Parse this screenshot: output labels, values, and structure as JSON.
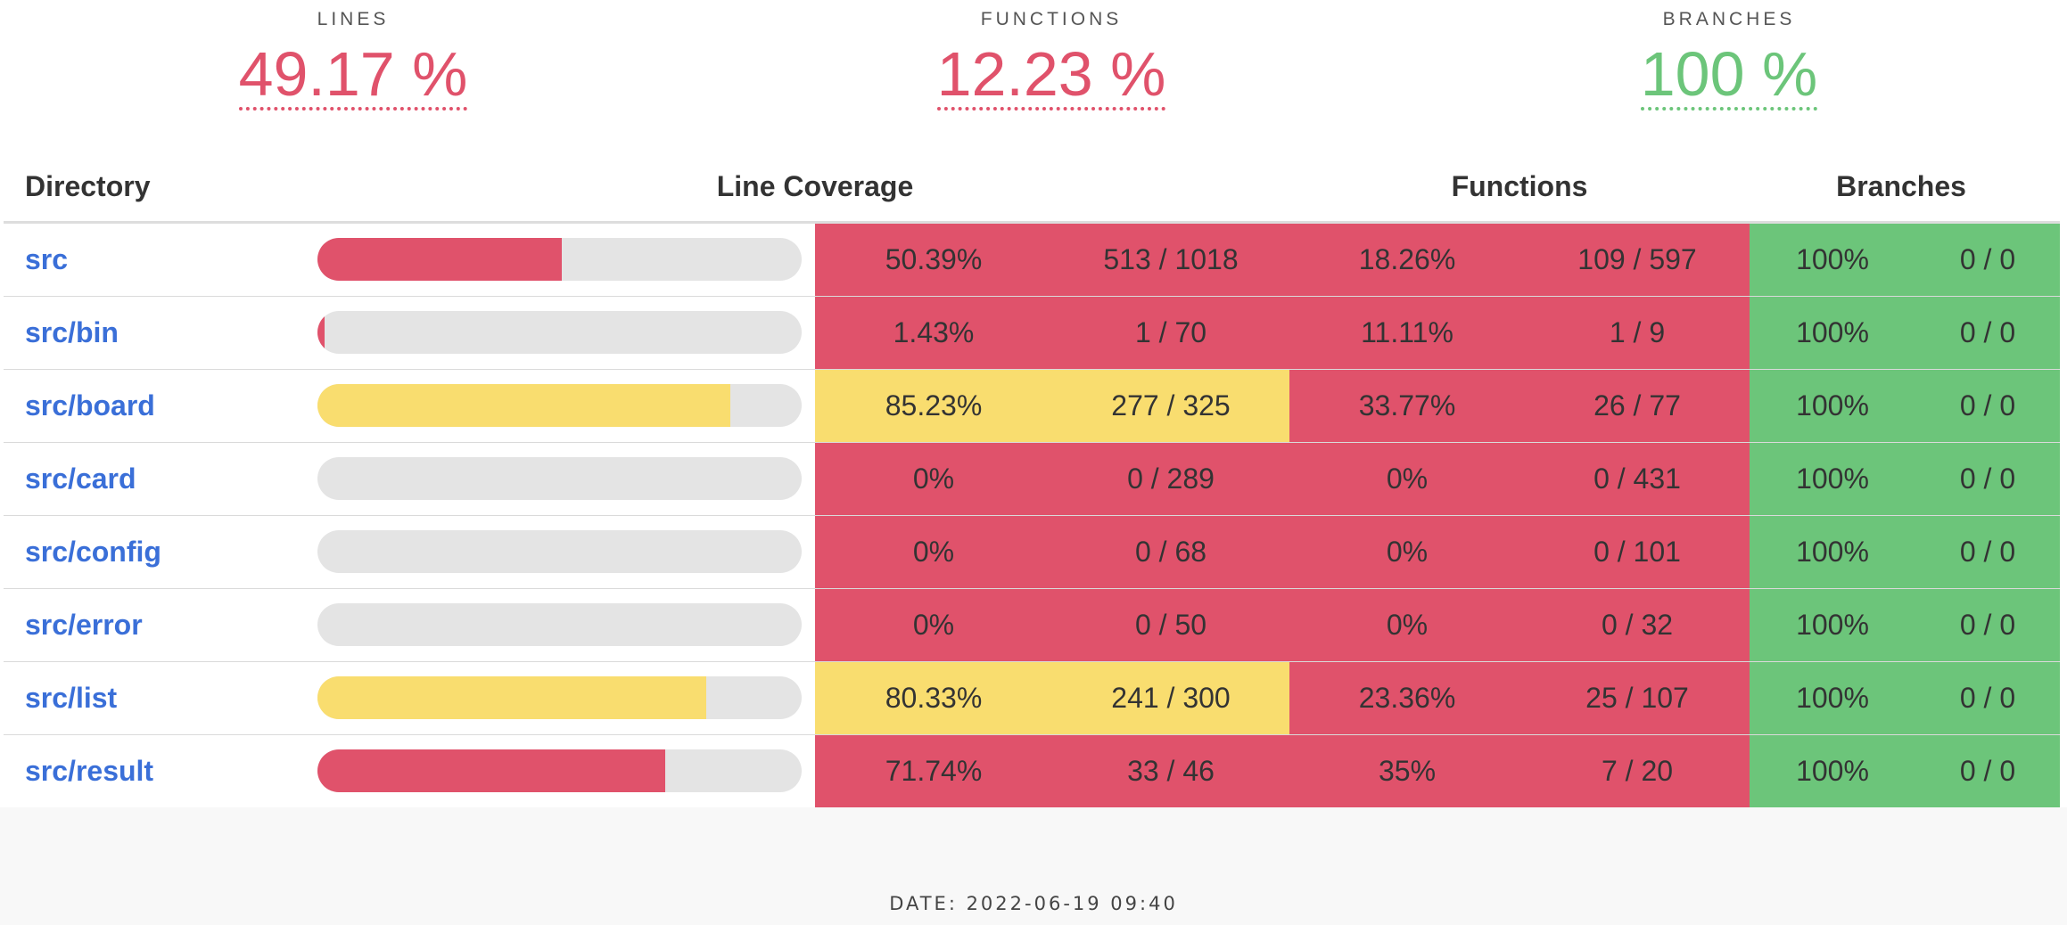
{
  "summary": [
    {
      "label": "LINES",
      "value": "49.17 %",
      "status": "low"
    },
    {
      "label": "FUNCTIONS",
      "value": "12.23 %",
      "status": "low"
    },
    {
      "label": "BRANCHES",
      "value": "100 %",
      "status": "high"
    }
  ],
  "table": {
    "headers": {
      "directory": "Directory",
      "line_coverage": "Line Coverage",
      "functions": "Functions",
      "branches": "Branches"
    },
    "rows": [
      {
        "dir": "src",
        "line_ratio": 0.5039,
        "line_pct": "50.39%",
        "line_count": "513 / 1018",
        "line_status": "low",
        "func_pct": "18.26%",
        "func_count": "109 / 597",
        "func_status": "low",
        "branch_pct": "100%",
        "branch_count": "0 / 0",
        "branch_status": "high"
      },
      {
        "dir": "src/bin",
        "line_ratio": 0.0143,
        "line_pct": "1.43%",
        "line_count": "1 / 70",
        "line_status": "low",
        "func_pct": "11.11%",
        "func_count": "1 / 9",
        "func_status": "low",
        "branch_pct": "100%",
        "branch_count": "0 / 0",
        "branch_status": "high"
      },
      {
        "dir": "src/board",
        "line_ratio": 0.8523,
        "line_pct": "85.23%",
        "line_count": "277 / 325",
        "line_status": "med",
        "func_pct": "33.77%",
        "func_count": "26 / 77",
        "func_status": "low",
        "branch_pct": "100%",
        "branch_count": "0 / 0",
        "branch_status": "high"
      },
      {
        "dir": "src/card",
        "line_ratio": 0,
        "line_pct": "0%",
        "line_count": "0 / 289",
        "line_status": "low",
        "func_pct": "0%",
        "func_count": "0 / 431",
        "func_status": "low",
        "branch_pct": "100%",
        "branch_count": "0 / 0",
        "branch_status": "high"
      },
      {
        "dir": "src/config",
        "line_ratio": 0,
        "line_pct": "0%",
        "line_count": "0 / 68",
        "line_status": "low",
        "func_pct": "0%",
        "func_count": "0 / 101",
        "func_status": "low",
        "branch_pct": "100%",
        "branch_count": "0 / 0",
        "branch_status": "high"
      },
      {
        "dir": "src/error",
        "line_ratio": 0,
        "line_pct": "0%",
        "line_count": "0 / 50",
        "line_status": "low",
        "func_pct": "0%",
        "func_count": "0 / 32",
        "func_status": "low",
        "branch_pct": "100%",
        "branch_count": "0 / 0",
        "branch_status": "high"
      },
      {
        "dir": "src/list",
        "line_ratio": 0.8033,
        "line_pct": "80.33%",
        "line_count": "241 / 300",
        "line_status": "med",
        "func_pct": "23.36%",
        "func_count": "25 / 107",
        "func_status": "low",
        "branch_pct": "100%",
        "branch_count": "0 / 0",
        "branch_status": "high"
      },
      {
        "dir": "src/result",
        "line_ratio": 0.7174,
        "line_pct": "71.74%",
        "line_count": "33 / 46",
        "line_status": "low",
        "func_pct": "35%",
        "func_count": "7 / 20",
        "func_status": "low",
        "branch_pct": "100%",
        "branch_count": "0 / 0",
        "branch_status": "high"
      }
    ]
  },
  "footer": {
    "date": "DATE: 2022-06-19 09:40"
  },
  "colors": {
    "low": "#e0526b",
    "med": "#f9dd6f",
    "high": "#6cc57a",
    "link": "#3a6fd8",
    "track": "#e4e4e4"
  }
}
